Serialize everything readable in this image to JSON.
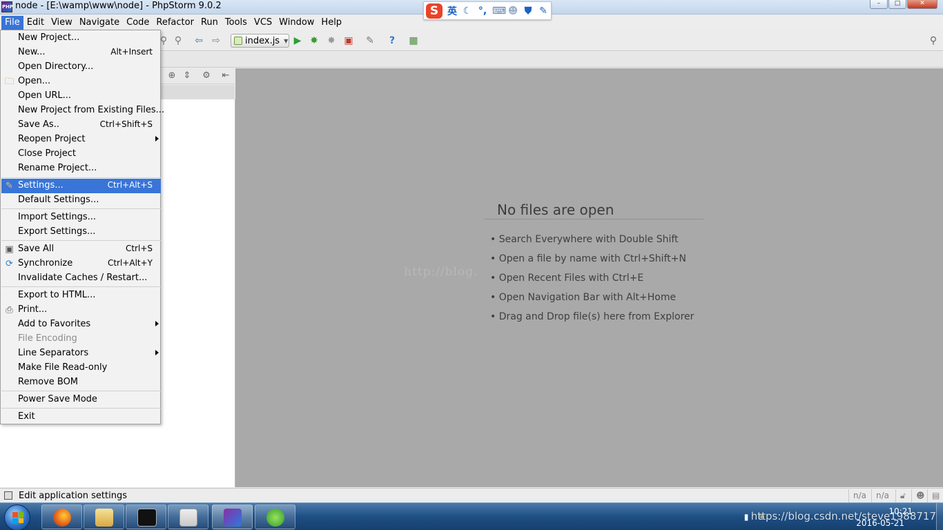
{
  "window": {
    "title": "node - [E:\\wamp\\www\\node] - PhpStorm 9.0.2",
    "app_icon_text": "PHP",
    "controls": {
      "minimize": "–",
      "maximize": "□",
      "close": "✕"
    }
  },
  "ime": {
    "logo": "S",
    "mode": "英"
  },
  "menubar": {
    "items": [
      {
        "label": "File",
        "mnemonic": "F"
      },
      {
        "label": "Edit",
        "mnemonic": "E"
      },
      {
        "label": "View",
        "mnemonic": "V"
      },
      {
        "label": "Navigate",
        "mnemonic": "N"
      },
      {
        "label": "Code",
        "mnemonic": "C"
      },
      {
        "label": "Refactor",
        "mnemonic": "R"
      },
      {
        "label": "Run",
        "mnemonic": "u"
      },
      {
        "label": "Tools",
        "mnemonic": "T"
      },
      {
        "label": "VCS",
        "mnemonic": "S"
      },
      {
        "label": "Window",
        "mnemonic": "W"
      },
      {
        "label": "Help",
        "mnemonic": "H"
      }
    ],
    "active": "File"
  },
  "toolbar": {
    "run_config": "index.js"
  },
  "file_menu": {
    "items": [
      {
        "label": "New Project...",
        "shortcut": ""
      },
      {
        "label": "New...",
        "shortcut": "Alt+Insert"
      },
      {
        "label": "Open Directory...",
        "shortcut": ""
      },
      {
        "label": "Open...",
        "shortcut": "",
        "icon": "folder-icon"
      },
      {
        "label": "Open URL...",
        "shortcut": ""
      },
      {
        "label": "New Project from Existing Files...",
        "shortcut": ""
      },
      {
        "label": "Save As..",
        "shortcut": "Ctrl+Shift+S"
      },
      {
        "label": "Reopen Project",
        "shortcut": "",
        "submenu": true
      },
      {
        "label": "Close Project",
        "shortcut": ""
      },
      {
        "label": "Rename Project...",
        "shortcut": ""
      },
      {
        "label": "Settings...",
        "shortcut": "Ctrl+Alt+S",
        "icon": "wrench-icon",
        "highlighted": true
      },
      {
        "label": "Default Settings...",
        "shortcut": ""
      },
      {
        "label": "Import Settings...",
        "shortcut": ""
      },
      {
        "label": "Export Settings...",
        "shortcut": ""
      },
      {
        "label": "Save All",
        "shortcut": "Ctrl+S",
        "icon": "save-icon"
      },
      {
        "label": "Synchronize",
        "shortcut": "Ctrl+Alt+Y",
        "icon": "sync-icon"
      },
      {
        "label": "Invalidate Caches / Restart...",
        "shortcut": ""
      },
      {
        "label": "Export to HTML...",
        "shortcut": ""
      },
      {
        "label": "Print...",
        "shortcut": "",
        "icon": "print-icon"
      },
      {
        "label": "Add to Favorites",
        "shortcut": "",
        "submenu": true
      },
      {
        "label": "File Encoding",
        "shortcut": "",
        "disabled": true
      },
      {
        "label": "Line Separators",
        "shortcut": "",
        "submenu": true
      },
      {
        "label": "Make File Read-only",
        "shortcut": ""
      },
      {
        "label": "Remove BOM",
        "shortcut": ""
      },
      {
        "label": "Power Save Mode",
        "shortcut": ""
      },
      {
        "label": "Exit",
        "shortcut": ""
      }
    ]
  },
  "editor": {
    "empty_title": "No files are open",
    "hints": [
      "• Search Everywhere with Double Shift",
      "• Open a file by name with Ctrl+Shift+N",
      "• Open Recent Files with Ctrl+E",
      "• Open Navigation Bar with Alt+Home",
      "• Drag and Drop file(s) here from Explorer"
    ],
    "watermark": "http://blog."
  },
  "statusbar": {
    "text": "Edit application settings",
    "cells": [
      "n/a",
      "n/a"
    ]
  },
  "taskbar": {
    "clock_time": "10:21",
    "clock_date": "2016-05-21",
    "watermark": "https://blog.csdn.net/steve1988717"
  },
  "colors": {
    "selection": "#3875d7",
    "editor_bg": "#a9a9a9",
    "menu_bg": "#f2f2f2"
  }
}
